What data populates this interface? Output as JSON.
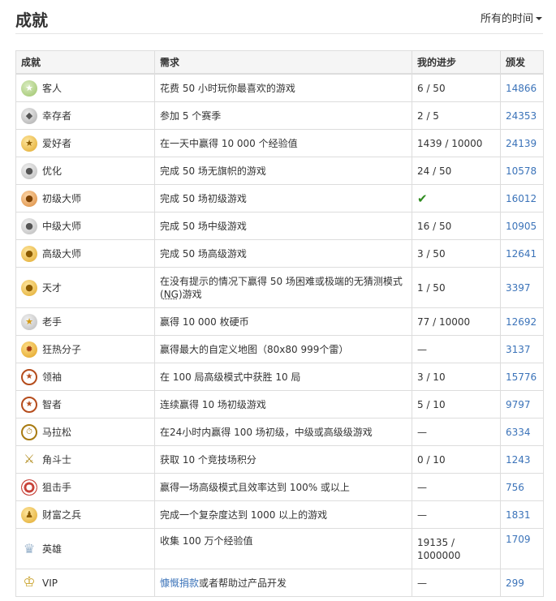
{
  "header": {
    "title": "成就",
    "time_filter": "所有的时间"
  },
  "table": {
    "columns": [
      "成就",
      "需求",
      "我的进步",
      "颁发"
    ],
    "rows": [
      {
        "icon": "star-medal-icon",
        "name": "客人",
        "requirement": "花费 50 小时玩你最喜欢的游戏",
        "progress": "6 / 50",
        "awarded": "14866"
      },
      {
        "icon": "survivor-medal-icon",
        "name": "幸存者",
        "requirement": "参加 5 个赛季",
        "progress": "2 / 5",
        "awarded": "24353"
      },
      {
        "icon": "fan-star-icon",
        "name": "爱好者",
        "requirement": "在一天中赢得 10 000 个经验值",
        "progress": "1439 / 10000",
        "awarded": "24139"
      },
      {
        "icon": "optimizer-medal-icon",
        "name": "优化",
        "requirement": "完成 50 场无旗帜的游戏",
        "progress": "24 / 50",
        "awarded": "10578"
      },
      {
        "icon": "bronze-medal-icon",
        "name": "初级大师",
        "requirement": "完成 50 场初级游戏",
        "progress": "",
        "completed": true,
        "awarded": "16012"
      },
      {
        "icon": "silver-medal-icon",
        "name": "中级大师",
        "requirement": "完成 50 场中级游戏",
        "progress": "16 / 50",
        "awarded": "10905"
      },
      {
        "icon": "gold-medal-icon",
        "name": "高级大师",
        "requirement": "完成 50 场高级游戏",
        "progress": "3 / 50",
        "awarded": "12641"
      },
      {
        "icon": "genius-medal-icon",
        "name": "天才",
        "requirement_line1": "在没有提示的情况下赢得 50 场困难或极端的无猜测模式",
        "requirement_line2_pre": "(",
        "requirement_line2_abbr": "NG",
        "requirement_line2_post": ")游戏",
        "progress": "1 / 50",
        "awarded": "3397"
      },
      {
        "icon": "veteran-medal-icon",
        "name": "老手",
        "requirement": "赢得 10 000 枚硬币",
        "progress": "77 / 10000",
        "awarded": "12692"
      },
      {
        "icon": "fanatic-seal-icon",
        "name": "狂热分子",
        "requirement": "赢得最大的自定义地图（80x80 999个雷）",
        "progress": "—",
        "awarded": "3137"
      },
      {
        "icon": "leader-badge-icon",
        "name": "领袖",
        "requirement": "在 100 局高级模式中获胜 10 局",
        "progress": "3 / 10",
        "awarded": "15776"
      },
      {
        "icon": "wise-badge-icon",
        "name": "智者",
        "requirement": "连续赢得 10 场初级游戏",
        "progress": "5 / 10",
        "awarded": "9797"
      },
      {
        "icon": "stopwatch-icon",
        "name": "马拉松",
        "requirement": "在24小时内赢得 100 场初级，中级或高级级游戏",
        "progress": "—",
        "awarded": "6334"
      },
      {
        "icon": "crossed-swords-icon",
        "name": "角斗士",
        "requirement": "获取 10 个竞技场积分",
        "progress": "0 / 10",
        "awarded": "1243"
      },
      {
        "icon": "target-icon",
        "name": "狙击手",
        "requirement": "赢得一场高级模式且效率达到 100% 或以上",
        "progress": "—",
        "awarded": "756"
      },
      {
        "icon": "wealth-medal-icon",
        "name": "财富之兵",
        "requirement": "完成一个复杂度达到 1000 以上的游戏",
        "progress": "—",
        "awarded": "1831"
      },
      {
        "icon": "trophy-icon",
        "name": "英雄",
        "requirement": "收集 100 万个经验值",
        "progress_line1": "19135 /",
        "progress_line2": "1000000",
        "awarded": "1709"
      },
      {
        "icon": "crown-icon",
        "name": "VIP",
        "requirement_link": "慷慨捐款",
        "requirement_rest": "或者帮助过产品开发",
        "progress": "—",
        "awarded": "299"
      }
    ]
  },
  "colors": {
    "link": "#3b73b9",
    "check": "#2e8b1f",
    "header_bg": "#f5f5f5",
    "border": "#dddddd"
  }
}
